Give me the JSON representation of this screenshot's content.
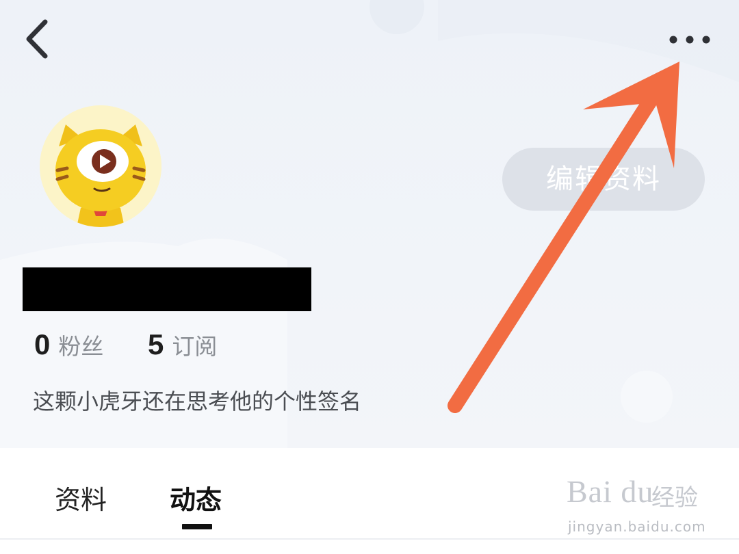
{
  "header": {
    "edit_profile_label": "编辑资料"
  },
  "stats": {
    "fans_count": "0",
    "fans_label": "粉丝",
    "subscribe_count": "5",
    "subscribe_label": "订阅"
  },
  "bio": "这颗小虎牙还在思考他的个性签名",
  "tabs": [
    {
      "label": "资料",
      "active": false
    },
    {
      "label": "动态",
      "active": true
    }
  ],
  "icons": {
    "back": "back-chevron-icon",
    "more": "more-dots-icon",
    "annotation": "orange-arrow-annotation"
  },
  "watermark": {
    "brand": "Bai du",
    "cn": "经验",
    "url": "jingyan.baidu.com"
  },
  "colors": {
    "arrow": "#f26c42",
    "header_bg": "#eef2f8",
    "edit_button_bg": "#dde1e8",
    "avatar_yellow": "#f5cc1f"
  }
}
